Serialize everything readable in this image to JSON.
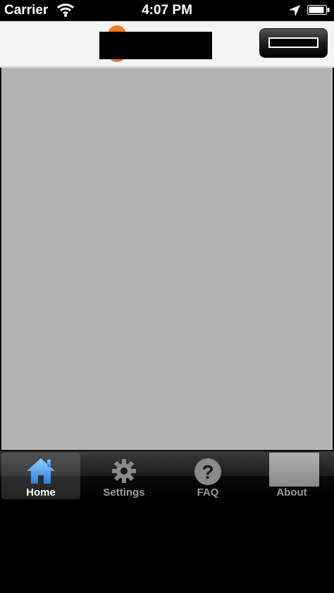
{
  "status_bar": {
    "carrier": "Carrier",
    "time": "4:07 PM"
  },
  "icons": {
    "wifi": "wifi-icon",
    "location": "location-arrow-icon",
    "battery": "battery-icon",
    "home": "home-icon",
    "settings": "gear-icon",
    "faq": "question-icon",
    "about": "about-image"
  },
  "tabs": [
    {
      "label": "Home",
      "selected": true
    },
    {
      "label": "Settings",
      "selected": false
    },
    {
      "label": "FAQ",
      "selected": false
    },
    {
      "label": "About",
      "selected": false
    }
  ],
  "colors": {
    "logo_orange": "#f07a1e",
    "home_icon_blue": "#5aa8f0",
    "content_gray": "#b2b2b2"
  }
}
